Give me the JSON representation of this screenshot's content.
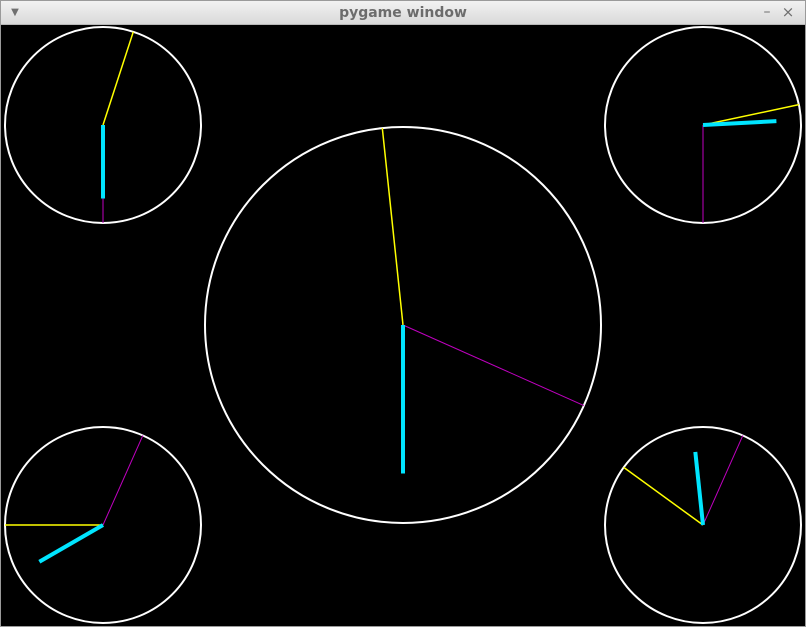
{
  "window": {
    "title": "pygame window",
    "menu_icon": "chevron-down-icon",
    "minimize_icon": "minimize-icon",
    "close_icon": "close-icon"
  },
  "colors": {
    "background": "#000000",
    "dial": "#ffffff",
    "hour_hand": "#00e5ff",
    "minute_hand": "#ffff00",
    "second_hand": "#c000c0"
  },
  "clocks": [
    {
      "name": "clock-large-center",
      "hour": 6.0,
      "minute": 59.0,
      "second": 19.0
    },
    {
      "name": "clock-top-left",
      "hour": 6.0,
      "minute": 3.0,
      "second": 30.0
    },
    {
      "name": "clock-top-right",
      "hour": 2.9,
      "minute": 13.0,
      "second": 30.0
    },
    {
      "name": "clock-bottom-left",
      "hour": 8.0,
      "minute": 45.0,
      "second": 4.0
    },
    {
      "name": "clock-bottom-right",
      "hour": 11.8,
      "minute": 51.0,
      "second": 4.0
    }
  ]
}
